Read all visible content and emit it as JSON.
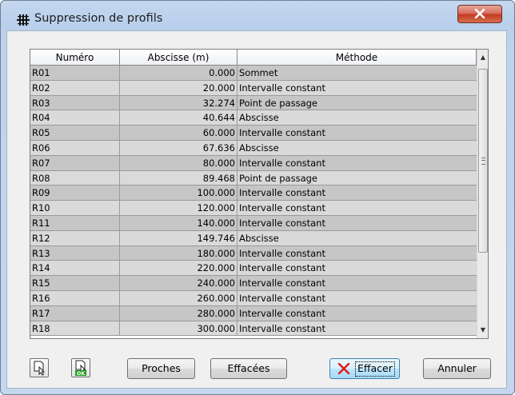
{
  "window": {
    "title": "Suppression de profils",
    "close_label": "X"
  },
  "table": {
    "headers": [
      "Numéro",
      "Abscisse (m)",
      "Méthode"
    ],
    "rows": [
      [
        "R01",
        "0.000",
        "Sommet"
      ],
      [
        "R02",
        "20.000",
        "Intervalle constant"
      ],
      [
        "R03",
        "32.274",
        "Point de passage"
      ],
      [
        "R04",
        "40.644",
        "Abscisse"
      ],
      [
        "R05",
        "60.000",
        "Intervalle constant"
      ],
      [
        "R06",
        "67.636",
        "Abscisse"
      ],
      [
        "R07",
        "80.000",
        "Intervalle constant"
      ],
      [
        "R08",
        "89.468",
        "Point de passage"
      ],
      [
        "R09",
        "100.000",
        "Intervalle constant"
      ],
      [
        "R10",
        "120.000",
        "Intervalle constant"
      ],
      [
        "R11",
        "140.000",
        "Intervalle constant"
      ],
      [
        "R12",
        "149.746",
        "Abscisse"
      ],
      [
        "R13",
        "180.000",
        "Intervalle constant"
      ],
      [
        "R14",
        "220.000",
        "Intervalle constant"
      ],
      [
        "R15",
        "240.000",
        "Intervalle constant"
      ],
      [
        "R16",
        "260.000",
        "Intervalle constant"
      ],
      [
        "R17",
        "280.000",
        "Intervalle constant"
      ],
      [
        "R18",
        "300.000",
        "Intervalle constant"
      ]
    ]
  },
  "footer": {
    "select_icon": "select-cursor-icon",
    "select_ok_icon": "select-ok-icon",
    "select_ok_badge": "OK",
    "proches_label": "Proches",
    "effacees_label": "Effacées",
    "effacer_label": "Effacer",
    "annuler_label": "Annuler"
  },
  "colors": {
    "close_red": "#c43a23",
    "ok_green": "#1e9a1e",
    "delete_red": "#e01818"
  }
}
